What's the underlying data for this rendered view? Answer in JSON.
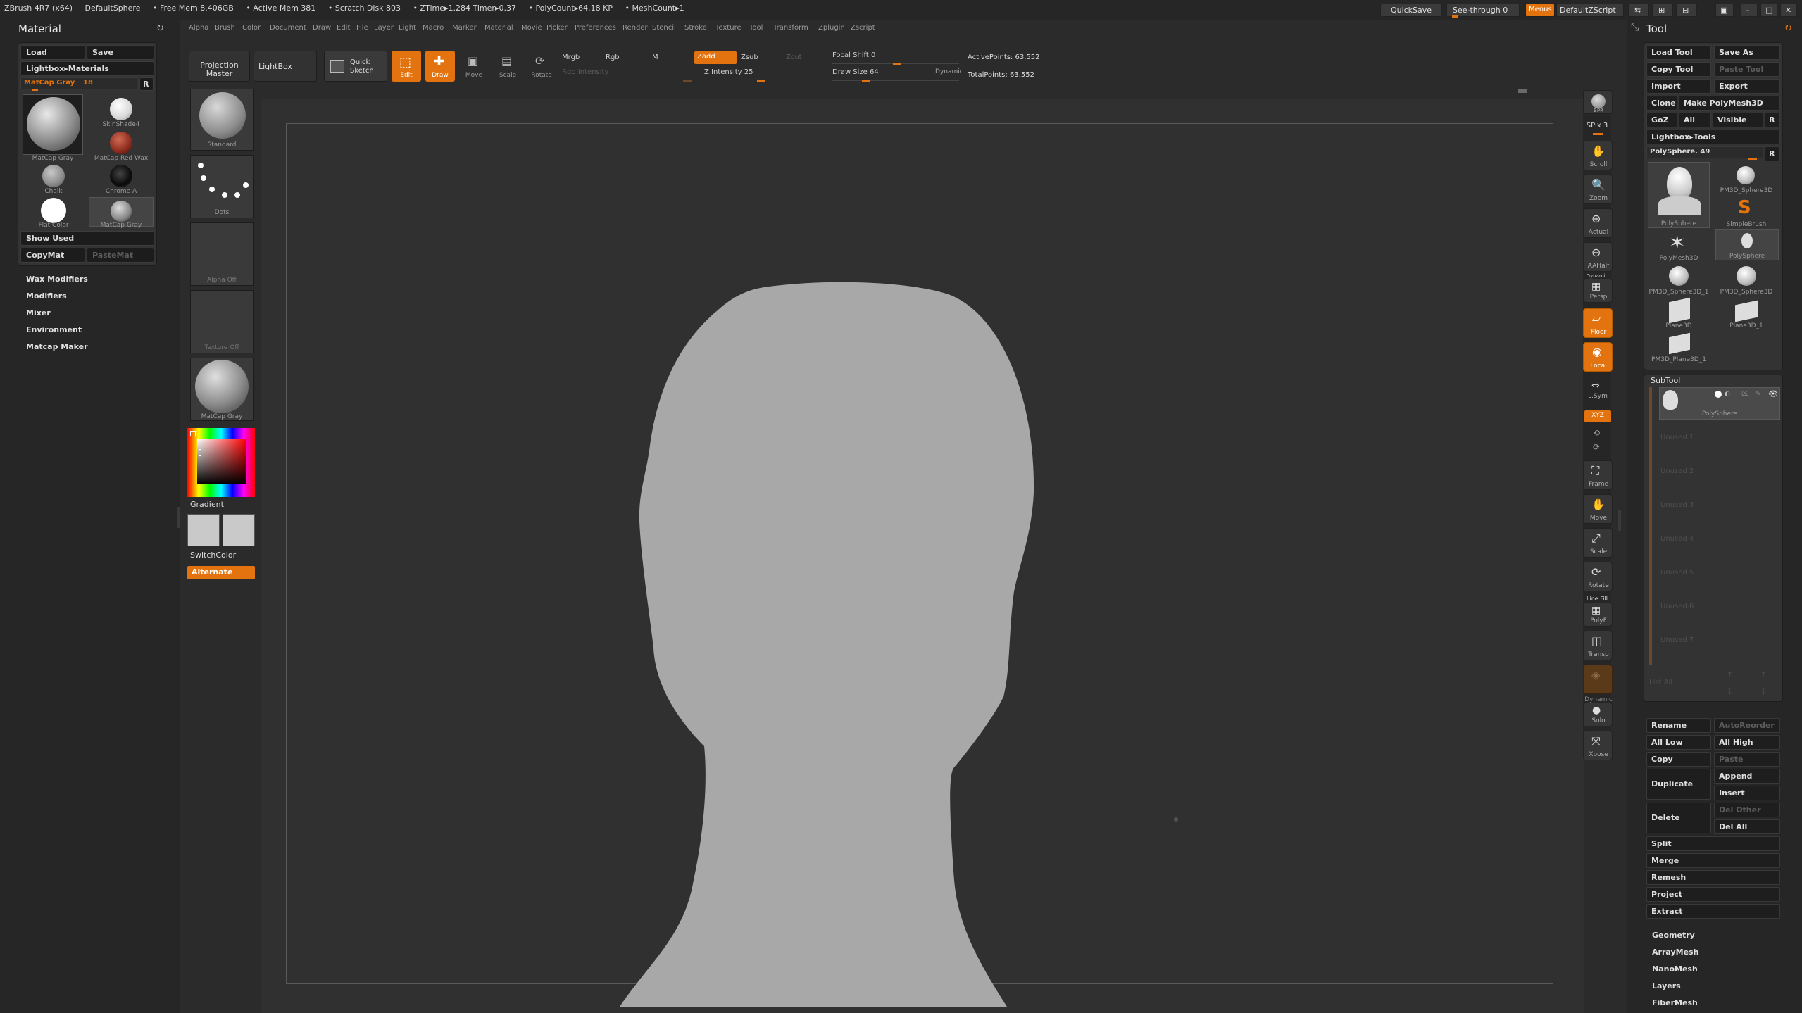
{
  "titlebar": {
    "app": "ZBrush 4R7 (x64)",
    "doc": "DefaultSphere",
    "free_mem": "• Free Mem 8.406GB",
    "active_mem": "• Active Mem 381",
    "scratch": "• Scratch Disk 803",
    "ztime": "• ZTime▸1.284 Timer▸0.37",
    "polycount": "• PolyCount▸64.18 KP",
    "meshcount": "• MeshCount▸1",
    "quicksave": "QuickSave",
    "see_through": "See-through  0",
    "menus": "Menus",
    "defaultzscript": "DefaultZScript"
  },
  "menubar": [
    "Alpha",
    "Brush",
    "Color",
    "Document",
    "Draw",
    "Edit",
    "File",
    "Layer",
    "Light",
    "Macro",
    "Marker",
    "Material",
    "Movie",
    "Picker",
    "Preferences",
    "Render",
    "Stencil",
    "Stroke",
    "Texture",
    "Tool",
    "Transform",
    "Zplugin",
    "Zscript"
  ],
  "material_panel": {
    "title": "Material",
    "load": "Load",
    "save": "Save",
    "lightbox": "Lightbox▸Materials",
    "slider": "MatCap Gray",
    "slider_val": "18",
    "r": "R",
    "mats": [
      "MatCap Gray",
      "SkinShade4",
      "MatCap Red Wax",
      "Chalk",
      "Chrome A",
      "Flat Color",
      "MatCap Gray"
    ],
    "show_used": "Show Used",
    "copymat": "CopyMat",
    "pastemat": "PasteMat",
    "nav": [
      "Wax Modifiers",
      "Modifiers",
      "Mixer",
      "Environment",
      "Matcap Maker"
    ]
  },
  "shelf": {
    "projection": "Projection",
    "master": "Master",
    "lightbox": "LightBox",
    "quick": "Quick",
    "sketch": "Sketch",
    "edit": "Edit",
    "draw": "Draw",
    "move": "Move",
    "scale": "Scale",
    "rotate": "Rotate",
    "mrgb": "Mrgb",
    "rgb": "Rgb",
    "m": "M",
    "rgb_intensity": "Rgb Intensity",
    "zadd": "Zadd",
    "zsub": "Zsub",
    "zcut": "Zcut",
    "z_intensity": "Z Intensity 25",
    "focal_shift": "Focal Shift 0",
    "draw_size": "Draw Size 64",
    "dynamic": "Dynamic",
    "active_points": "ActivePoints: 63,552",
    "total_points": "TotalPoints: 63,552"
  },
  "brush_column": {
    "standard": "Standard",
    "dots": "Dots",
    "alpha_off": "Alpha  Off",
    "texture_off": "Texture  Off",
    "matcap": "MatCap Gray",
    "gradient": "Gradient",
    "switchcolor": "SwitchColor",
    "alternate": "Alternate"
  },
  "right_shelf": [
    "BPR",
    "SPix 3",
    "Scroll",
    "Zoom",
    "Actual",
    "AAHalf",
    "Persp",
    "Floor",
    "Local",
    "L.Sym",
    "XYZ",
    "Frame",
    "Move",
    "Scale",
    "Rotate",
    "PolyF",
    "Transp",
    "Dynamic",
    "Solo",
    "Xpose"
  ],
  "right_shelf_extra": {
    "dynamic_top": "Dynamic",
    "linefill": "Line Fill"
  },
  "tool_panel": {
    "title": "Tool",
    "load_tool": "Load Tool",
    "save_as": "Save As",
    "copy_tool": "Copy Tool",
    "paste_tool": "Paste Tool",
    "import": "Import",
    "export": "Export",
    "clone": "Clone",
    "make_polymesh": "Make PolyMesh3D",
    "goz": "GoZ",
    "all": "All",
    "visible": "Visible",
    "r": "R",
    "lightbox_tools": "Lightbox▸Tools",
    "polysphere_slider": "PolySphere. 49",
    "tools": [
      "PolySphere",
      "PM3D_Sphere3D",
      "SimpleBrush",
      "PolyMesh3D",
      "PolySphere",
      "PM3D_Sphere3D_1",
      "PM3D_Sphere3D",
      "Plane3D",
      "Plane3D_1",
      "PM3D_Plane3D_1"
    ],
    "subtool_title": "SubTool",
    "subtool_item": "PolySphere",
    "empty_slots": [
      "Unused 1",
      "Unused 2",
      "Unused 3",
      "Unused 4",
      "Unused 5",
      "Unused 6",
      "Unused 7"
    ],
    "list_all": "List All",
    "rename": "Rename",
    "autoreorder": "AutoReorder",
    "all_low": "All Low",
    "all_high": "All High",
    "copy": "Copy",
    "paste": "Paste",
    "duplicate": "Duplicate",
    "append": "Append",
    "insert": "Insert",
    "delete": "Delete",
    "del_other": "Del Other",
    "del_all": "Del All",
    "split": "Split",
    "merge": "Merge",
    "remesh": "Remesh",
    "project": "Project",
    "extract": "Extract",
    "sections": [
      "Geometry",
      "ArrayMesh",
      "NanoMesh",
      "Layers",
      "FiberMesh"
    ]
  },
  "colors": {
    "accent": "#e2730e",
    "canvas": "#303030",
    "model": "#a8a8a8"
  }
}
